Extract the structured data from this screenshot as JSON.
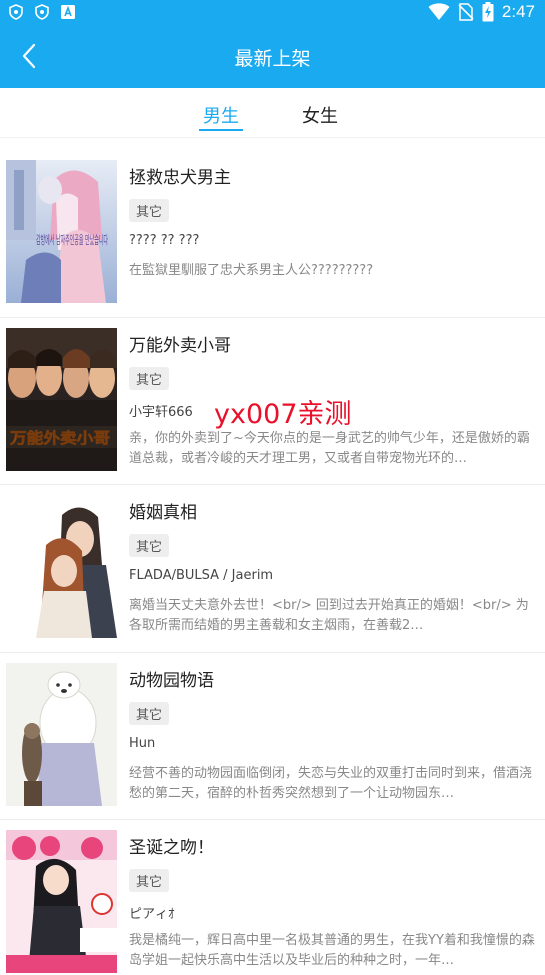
{
  "status_bar": {
    "time": "2:47",
    "left_icons": [
      "shield-icon",
      "shield-icon",
      "a-app-icon"
    ],
    "right_icons": [
      "wifi-icon",
      "no-sim-icon",
      "battery-charging-icon"
    ]
  },
  "header": {
    "title": "最新上架",
    "back_icon": "chevron-left-icon",
    "color": "#1aaaf0"
  },
  "tabs": [
    {
      "label": "男生",
      "active": true
    },
    {
      "label": "女生",
      "active": false
    }
  ],
  "books": [
    {
      "title": "拯救忠犬男主",
      "tag": "其它",
      "author": "???? ?? ???",
      "description": "在監獄里馴服了忠犬系男主人公?????????",
      "cover_text": "감방에서 남자주인공을 만났습니다"
    },
    {
      "title": "万能外卖小哥",
      "tag": "其它",
      "author": "小宇轩666",
      "description": "亲，你的外卖到了~今天你点的是一身武艺的帅气少年，还是傲娇的霸道总裁，或者冷峻的天才理工男，又或者自带宠物光环的…",
      "cover_text": "万能外卖小哥"
    },
    {
      "title": "婚姻真相",
      "tag": "其它",
      "author": "FLADA/BULSA / Jaerim",
      "description": "离婚当天丈夫意外去世！<br/>        回到过去开始真正的婚姻！<br/>        为各取所需而结婚的男主善载和女主烟雨，在善载2…"
    },
    {
      "title": "动物园物语",
      "tag": "其它",
      "author": "Hun",
      "description": "经营不善的动物园面临倒闭，失恋与失业的双重打击同时到来，借酒浇愁的第二天，宿醉的朴哲秀突然想到了一个让动物园东…"
    },
    {
      "title": "圣诞之吻！",
      "tag": "其它",
      "author": "ピアィｵ",
      "description": "我是橘纯一，辉日高中里一名极其普通的男生，在我YY着和我憧憬的森岛学姐一起快乐高中生活以及毕业后的种种之时，一年…"
    }
  ],
  "watermark": "yx007亲测"
}
